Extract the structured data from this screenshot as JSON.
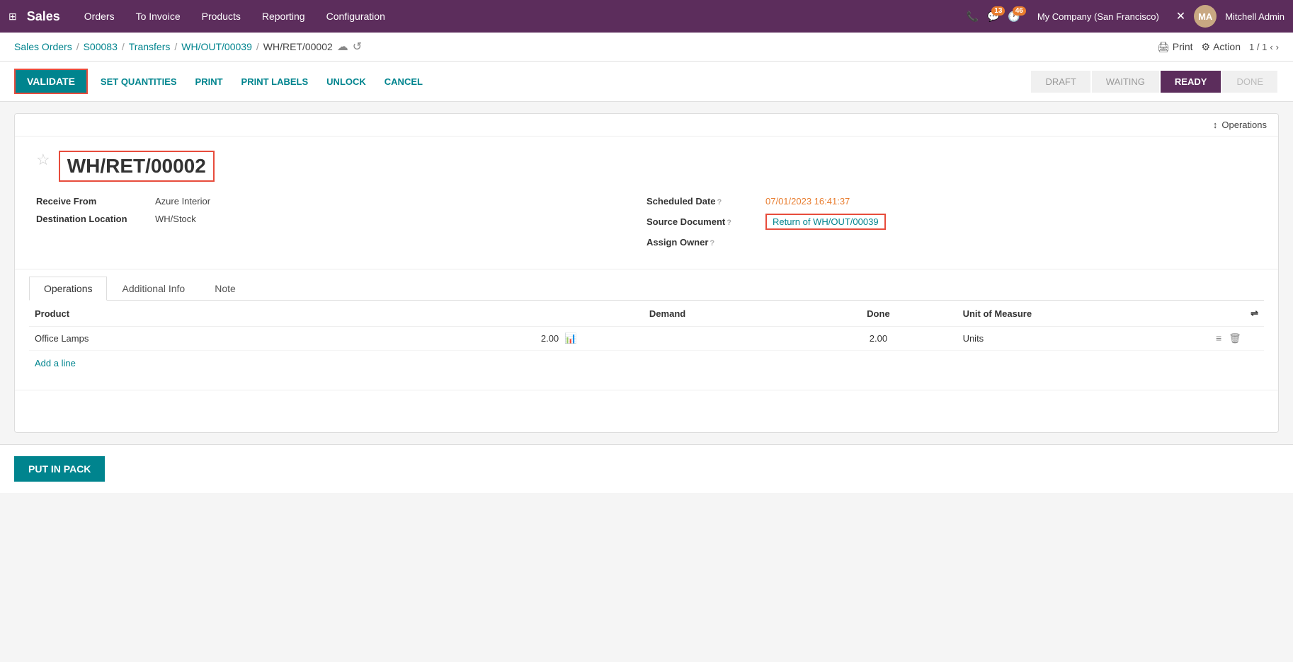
{
  "app": {
    "name": "Sales",
    "grid_icon": "⊞"
  },
  "top_nav": {
    "items": [
      "Orders",
      "To Invoice",
      "Products",
      "Reporting",
      "Configuration"
    ],
    "icons": {
      "phone": "📞",
      "chat": "💬",
      "chat_badge": "13",
      "clock": "🕐",
      "clock_badge": "46"
    },
    "company": "My Company (San Francisco)",
    "user": "Mitchell Admin",
    "close_icon": "✕"
  },
  "breadcrumb": {
    "items": [
      "Sales Orders",
      "S00083",
      "Transfers",
      "WH/OUT/00039",
      "WH/RET/00002"
    ],
    "cloud_icon": "☁",
    "refresh_icon": "↺"
  },
  "breadcrumb_actions": {
    "print_label": "Print",
    "print_icon": "🖨",
    "action_label": "Action",
    "action_icon": "⚙",
    "counter": "1 / 1",
    "prev_icon": "‹",
    "next_icon": "›"
  },
  "action_bar": {
    "validate_label": "VALIDATE",
    "set_quantities_label": "SET QUANTITIES",
    "print_label": "PRINT",
    "print_labels_label": "PRINT LABELS",
    "unlock_label": "UNLOCK",
    "cancel_label": "CANCEL"
  },
  "status_steps": [
    {
      "label": "DRAFT",
      "state": "inactive"
    },
    {
      "label": "WAITING",
      "state": "inactive"
    },
    {
      "label": "READY",
      "state": "active"
    },
    {
      "label": "DONE",
      "state": "inactive"
    }
  ],
  "operations_panel": {
    "icon": "↕",
    "label": "Operations"
  },
  "record": {
    "star_icon": "☆",
    "title": "WH/RET/00002",
    "receive_from_label": "Receive From",
    "receive_from_value": "Azure Interior",
    "destination_label": "Destination Location",
    "destination_value": "WH/Stock",
    "scheduled_date_label": "Scheduled Date",
    "scheduled_date_value": "07/01/2023 16:41:37",
    "source_doc_label": "Source Document",
    "source_doc_value": "Return of WH/OUT/00039",
    "assign_owner_label": "Assign Owner"
  },
  "tabs": [
    "Operations",
    "Additional Info",
    "Note"
  ],
  "active_tab": "Operations",
  "table": {
    "columns": {
      "product": "Product",
      "demand": "Demand",
      "done": "Done",
      "uom": "Unit of Measure"
    },
    "rows": [
      {
        "product": "Office Lamps",
        "demand": "2.00",
        "done": "2.00",
        "uom": "Units"
      }
    ],
    "add_line": "Add a line"
  },
  "footer": {
    "put_in_pack_label": "PUT IN PACK"
  }
}
